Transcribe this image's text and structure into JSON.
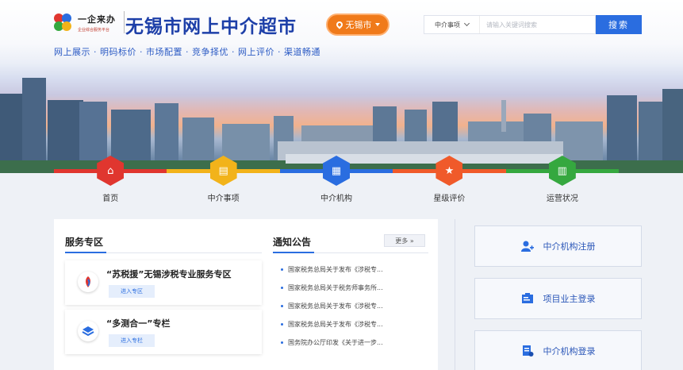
{
  "header": {
    "logo_text": "一企来办",
    "logo_sub": "企业综合服务平台",
    "site_title": "无锡市网上中介超市",
    "city": "无锡市",
    "slogan": "网上展示 · 明码标价 · 市场配置 · 竞争择优 · 网上评价 · 渠道畅通"
  },
  "search": {
    "category": "中介事项",
    "placeholder": "请输入关键词搜索",
    "button": "搜索"
  },
  "nav": [
    {
      "label": "首页",
      "icon": "home-icon",
      "color": "#e0362f"
    },
    {
      "label": "中介事项",
      "icon": "document-icon",
      "color": "#f2b31a"
    },
    {
      "label": "中介机构",
      "icon": "building-icon",
      "color": "#2a6de0"
    },
    {
      "label": "星级评价",
      "icon": "star-icon",
      "color": "#f05a2a"
    },
    {
      "label": "运营状况",
      "icon": "chart-icon",
      "color": "#35a83f"
    }
  ],
  "service": {
    "title": "服务专区",
    "items": [
      {
        "title": "“苏税援”无锡涉税专业服务专区",
        "button": "进入专区",
        "icon": "tax-service-icon"
      },
      {
        "title": "“多测合一”专栏",
        "button": "进入专栏",
        "icon": "layers-icon"
      }
    ]
  },
  "notice": {
    "title": "通知公告",
    "more": "更多 »",
    "items": [
      "国家税务总局关于发布《涉税专...",
      "国家税务总局关于税务师事务所...",
      "国家税务总局关于发布《涉税专...",
      "国家税务总局关于发布《涉税专...",
      "国务院办公厅印发《关于进一步..."
    ]
  },
  "side": [
    {
      "label": "中介机构注册",
      "icon": "user-register-icon"
    },
    {
      "label": "项目业主登录",
      "icon": "owner-login-icon"
    },
    {
      "label": "中介机构登录",
      "icon": "agency-login-icon"
    }
  ]
}
